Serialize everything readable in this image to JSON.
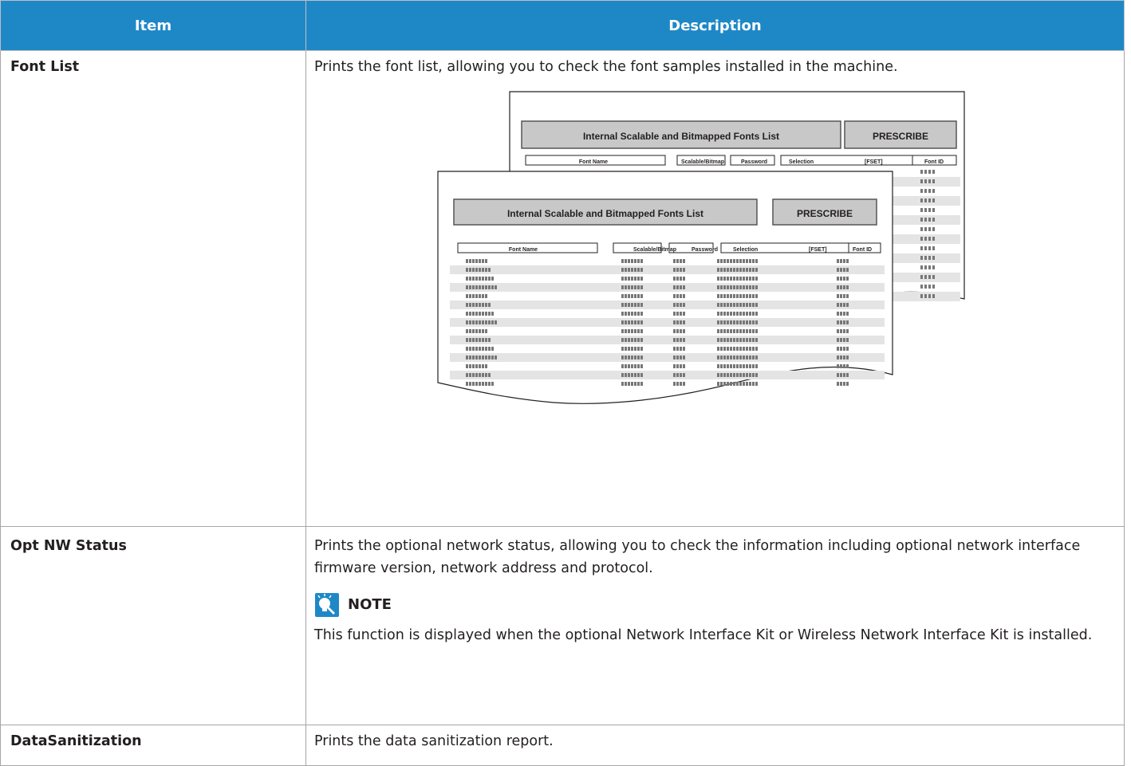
{
  "table": {
    "headers": {
      "item": "Item",
      "description": "Description"
    },
    "rows": {
      "font_list": {
        "item": "Font List",
        "description": "Prints the font list, allowing you to check the font samples installed in the machine.",
        "illustration": {
          "back_title": "Internal Scalable and Bitmapped Fonts List",
          "front_title": "Internal Scalable and Bitmapped Fonts List",
          "badge": "PRESCRIBE",
          "columns": [
            "Font Name",
            "Scalable/Bitmap",
            "Password",
            "Selection",
            "[FSET]",
            "Font ID"
          ]
        }
      },
      "opt_nw_status": {
        "item": "Opt NW Status",
        "description": "Prints the optional network status, allowing you to check the information including optional network interface firmware version, network address and protocol.",
        "note_label": "NOTE",
        "note_icon": "note-lightbulb-icon",
        "note_text": "This function is displayed when the optional Network Interface Kit or Wireless Network Interface Kit is installed."
      },
      "data_sanitization": {
        "item": "DataSanitization",
        "description": "Prints the data sanitization report."
      }
    }
  },
  "colors": {
    "header_bg": "#1e88c7",
    "header_text": "#ffffff",
    "note_icon": "#1e88c7"
  }
}
